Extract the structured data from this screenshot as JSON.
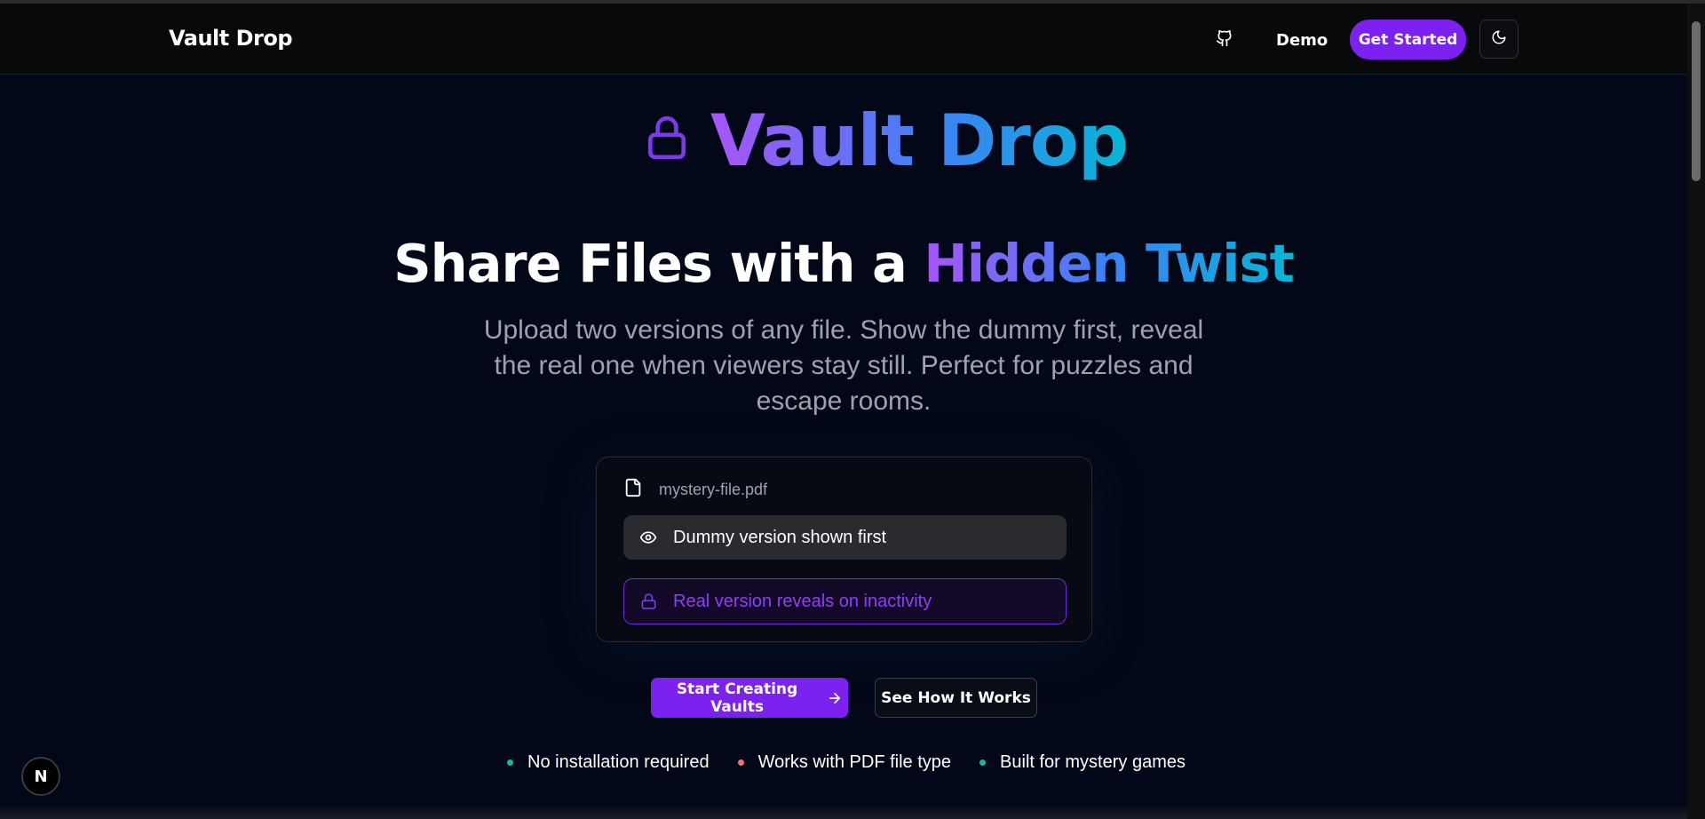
{
  "navbar": {
    "brand": "Vault Drop",
    "github_icon": "github-icon",
    "demo_label": "Demo",
    "get_started_label": "Get Started",
    "theme_icon": "moon-icon"
  },
  "hero": {
    "logo_icon": "lock-icon",
    "logo_text": "Vault Drop",
    "headline_plain": "Share Files with a",
    "headline_highlight": "Hidden Twist",
    "subtitle": "Upload two versions of any file. Show the dummy first, reveal the real one when viewers stay still. Perfect for puzzles and escape rooms."
  },
  "card": {
    "file_icon": "file-icon",
    "file_name": "mystery-file.pdf",
    "dummy_icon": "eye-icon",
    "dummy_text": "Dummy version shown first",
    "real_icon": "lock-icon",
    "real_text": "Real version reveals on inactivity"
  },
  "actions": {
    "primary_label": "Start Creating Vaults",
    "primary_icon": "arrow-right-icon",
    "secondary_label": "See How It Works"
  },
  "features": [
    {
      "label": "No installation required",
      "color": "#14b8a6"
    },
    {
      "label": "Works with PDF file type",
      "color": "#f87171"
    },
    {
      "label": "Built for mystery games",
      "color": "#14b8a6"
    }
  ],
  "badge": {
    "label": "N"
  },
  "colors": {
    "background": "#020817",
    "accent": "#7c22f0",
    "gradient_start": "#a855f7",
    "gradient_end": "#06b6d4"
  }
}
